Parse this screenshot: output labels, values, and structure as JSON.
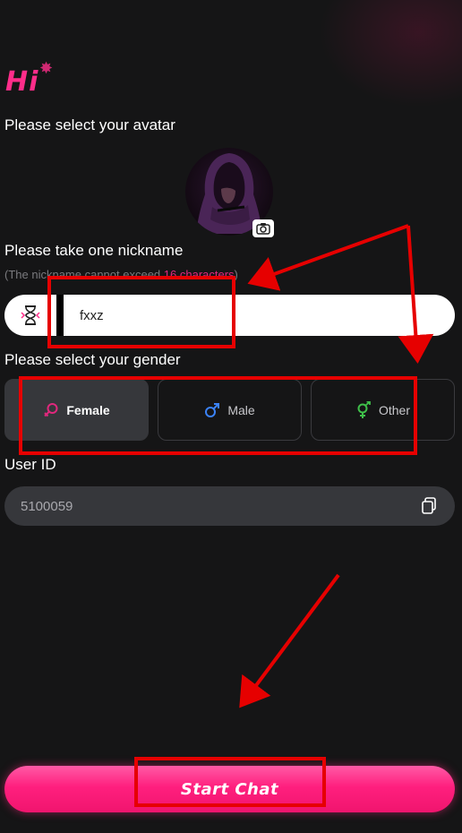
{
  "header": {
    "greeting": "Hi"
  },
  "avatar_section": {
    "label": "Please select your avatar"
  },
  "nickname_section": {
    "label": "Please take one nickname",
    "hint_prefix": "(The nickname cannot exceed ",
    "hint_highlight": "16 characters",
    "hint_suffix": ")",
    "value": "fxxz"
  },
  "gender_section": {
    "label": "Please select your gender",
    "options": [
      {
        "label": "Female",
        "selected": true,
        "icon": "female-icon",
        "color": "#e0287d"
      },
      {
        "label": "Male",
        "selected": false,
        "icon": "male-icon",
        "color": "#3b82f6"
      },
      {
        "label": "Other",
        "selected": false,
        "icon": "transgender-icon",
        "color": "#3fbf4a"
      }
    ]
  },
  "user_id_section": {
    "label": "User ID",
    "value": "5100059"
  },
  "start_button": {
    "label": "Start Chat"
  },
  "colors": {
    "accent": "#ff1f7e",
    "annotation": "#e60000",
    "background": "#151516"
  }
}
